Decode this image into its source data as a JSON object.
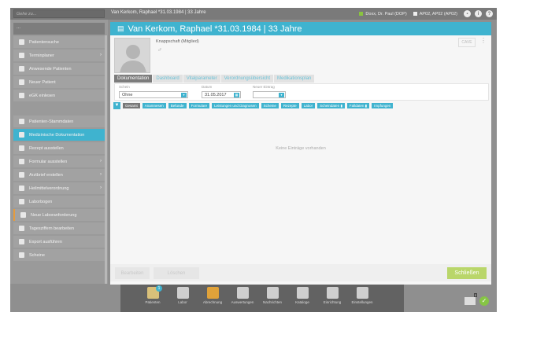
{
  "topbar": {
    "search_placeholder": "Gehe zu...",
    "title": "Van Kerkom, Raphael *31.03.1984 | 33 Jahre",
    "doctor": "Doxx, Dr. Paul (DOP)",
    "workstation": "AP02, AP02 (AP02)",
    "help": "?"
  },
  "sidebar": {
    "top": "...",
    "items_a": [
      {
        "label": "Patientensuche",
        "arrow": ""
      },
      {
        "label": "Terminplaner",
        "arrow": "›"
      },
      {
        "label": "Anwesende Patienten",
        "arrow": ""
      },
      {
        "label": "Neuer Patient",
        "arrow": ""
      },
      {
        "label": "eGK einlesen",
        "arrow": ""
      }
    ],
    "items_b": [
      {
        "label": "Patienten-Stammdaten",
        "arrow": ""
      },
      {
        "label": "Medizinische Dokumentation",
        "arrow": ""
      },
      {
        "label": "Rezept ausstellen",
        "arrow": ""
      },
      {
        "label": "Formular ausstellen",
        "arrow": "›"
      },
      {
        "label": "Arztbrief erstellen",
        "arrow": "›"
      },
      {
        "label": "Heilmittelverordnung",
        "arrow": "›"
      },
      {
        "label": "Laborbogen",
        "arrow": ""
      },
      {
        "label": "Neue Laboranforderung",
        "arrow": ""
      },
      {
        "label": "Tagesziffern bearbeiten",
        "arrow": ""
      },
      {
        "label": "Export ausführen",
        "arrow": ""
      },
      {
        "label": "Scheine",
        "arrow": ""
      }
    ]
  },
  "main": {
    "header": "Van Kerkom, Raphael *31.03.1984 | 33 Jahre",
    "insurer": "Knappschaft (Mitglied)",
    "gender_symbol": "♂",
    "cave": "CAVE",
    "more": "⋮",
    "tabs": [
      "Dokumentation",
      "Dashboard",
      "Vitalparameter",
      "Verordnungsübersicht",
      "Medikationsplan"
    ],
    "filter": {
      "schein_label": "Schein",
      "schein_value": "Ohne",
      "datum_label": "Datum",
      "datum_value": "31.05.2017",
      "neuer_label": "Neuer Eintrag",
      "neuer_value": ""
    },
    "chips": [
      "Gesamt",
      "Anamnesen",
      "Befunde",
      "Formulare",
      "Leistungen und Diagnosen",
      "Scheine",
      "Rezepte",
      "Labor",
      "Scheindaten ▮",
      "Falldaten ▮",
      "Impfungen"
    ],
    "empty_text": "Keine Einträge vorhanden",
    "footer": {
      "edit": "Bearbeiten",
      "delete": "Löschen",
      "close": "Schließen"
    }
  },
  "dock": {
    "items": [
      {
        "label": "Patienten",
        "color": "#d9c07a"
      },
      {
        "label": "Labor",
        "color": "#cfcfcf"
      },
      {
        "label": "Abrechnung",
        "color": "#e0a23a"
      },
      {
        "label": "Auswertungen",
        "color": "#cfcfcf"
      },
      {
        "label": "Nachrichten",
        "color": "#cfcfcf"
      },
      {
        "label": "Kataloge",
        "color": "#cfcfcf"
      },
      {
        "label": "Einrichtung",
        "color": "#cfcfcf"
      },
      {
        "label": "Einstellungen",
        "color": "#cfcfcf"
      }
    ],
    "patients_badge": "1",
    "mail_count": "2"
  },
  "colors": {
    "accent": "#3fb3cf",
    "success": "#b9d66a",
    "status_green": "#86c545"
  }
}
